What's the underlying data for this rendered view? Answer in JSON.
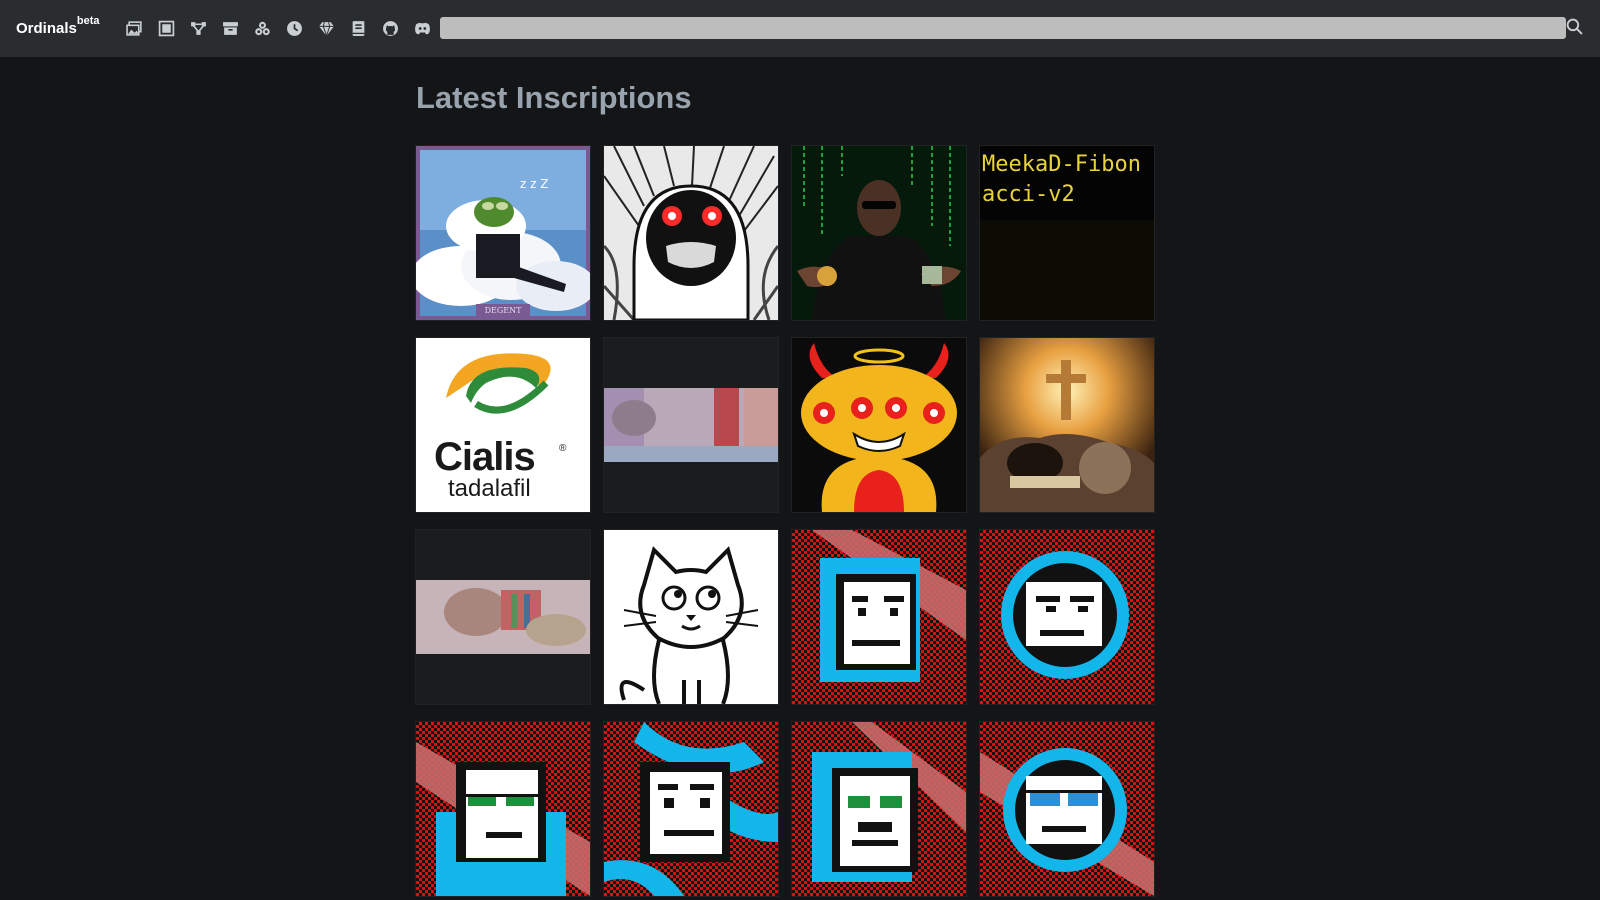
{
  "navbar": {
    "brand": "Ordinals",
    "brand_sup": "beta",
    "icons": [
      "gallery-icon",
      "block-icon",
      "rune-icon",
      "archive-icon",
      "collections-icon",
      "clock-icon",
      "rare-sats-icon",
      "book-icon",
      "github-icon",
      "discord-icon"
    ],
    "search": {
      "value": "",
      "placeholder": ""
    }
  },
  "page": {
    "title": "Latest Inscriptions"
  },
  "inscriptions": [
    {
      "kind": "image",
      "subject": "pepe-on-cloud",
      "caption": "DEGENT"
    },
    {
      "kind": "image",
      "subject": "screaming-tree-creature"
    },
    {
      "kind": "image",
      "subject": "matrix-bitcoin-offer"
    },
    {
      "kind": "text",
      "text": "MeekaD-Fibonacci-v2"
    },
    {
      "kind": "image",
      "subject": "cialis-logo",
      "brand": "Cialis",
      "sub": "tadalafil",
      "mark": "®"
    },
    {
      "kind": "image",
      "subject": "painting-strip-1"
    },
    {
      "kind": "image",
      "subject": "horned-monster"
    },
    {
      "kind": "image",
      "subject": "cross-sunrise"
    },
    {
      "kind": "image",
      "subject": "painting-strip-2"
    },
    {
      "kind": "image",
      "subject": "cartoon-cat"
    },
    {
      "kind": "image",
      "subject": "pixel-face-square"
    },
    {
      "kind": "image",
      "subject": "pixel-face-round"
    },
    {
      "kind": "image",
      "subject": "pixel-face-glasses"
    },
    {
      "kind": "image",
      "subject": "pixel-face-waves"
    },
    {
      "kind": "image",
      "subject": "pixel-face-green"
    },
    {
      "kind": "image",
      "subject": "pixel-face-blue-glasses"
    }
  ],
  "colors": {
    "navbar": "#2a2d2f",
    "background": "#131516",
    "title": "#98a3ad",
    "text_tile": "#e8d23c"
  }
}
